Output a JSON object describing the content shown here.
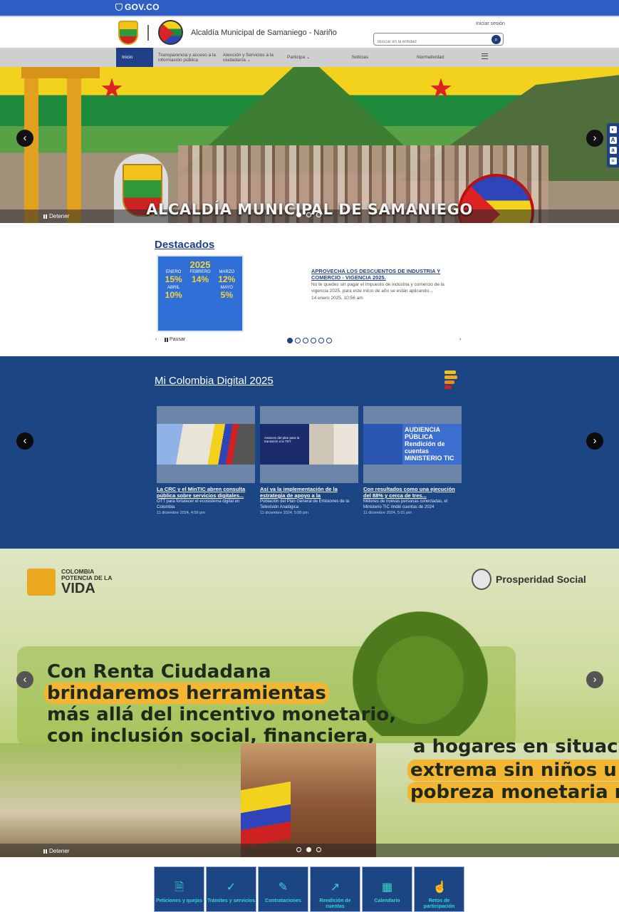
{
  "gov": {
    "logo_text": "GOV.CO"
  },
  "header": {
    "municipality_name": "Alcaldía Municipal de Samaniego - Nariño",
    "login_link": "Iniciar sesión",
    "search_placeholder": "Buscar en la entidad"
  },
  "nav": {
    "items": [
      {
        "label": "Inicio"
      },
      {
        "label": "Transparencia y acceso a la información pública"
      },
      {
        "label": "Atención y Servicios a la ciudadanía ⌄"
      },
      {
        "label": "Participa ⌄"
      },
      {
        "label": "Noticias"
      },
      {
        "label": "Normatividad"
      }
    ]
  },
  "hero": {
    "title": "ALCALDÍA MUNICIPAL DE SAMANIEGO",
    "stop_label": "Detener",
    "slides_total": 3,
    "slide_active": 1,
    "prev_icon": "chevron-left-icon",
    "next_icon": "chevron-right-icon"
  },
  "destacados": {
    "title": "Destacados",
    "poster": {
      "year": "2025",
      "cells": [
        {
          "month": "ENERO",
          "pct": "15%"
        },
        {
          "month": "FEBRERO",
          "pct": "14%"
        },
        {
          "month": "MARZO",
          "pct": "12%"
        },
        {
          "month": "ABRIL",
          "pct": "10%"
        },
        {
          "month": "",
          "pct": ""
        },
        {
          "month": "MAYO",
          "pct": "5%"
        }
      ]
    },
    "news_title": "APROVECHA LOS DESCUENTOS DE INDUSTRIA Y COMERCIO - VIGENCIA 2025.",
    "news_desc": "No te quedes sin pagar el impuesto de industria y comercio de la vigencia 2025, para este inicio de año se están aplicando...",
    "news_date": "14 enero 2025, 10:56 am",
    "pause_label": "Pausar",
    "slides_total": 6,
    "slide_active": 1
  },
  "mcd": {
    "title": "Mi Colombia Digital 2025",
    "cards": [
      {
        "title": "La CRC y el MinTIC abren consulta pública sobre servicios digitales...",
        "desc": "OTT para fortalecer el ecosistema digital en Colombia",
        "date": "11 diciembre 2024, 4:59 pm"
      },
      {
        "title": "Así va la implementación de la estrategia de apoyo a la",
        "desc": "Población del Plan General de Emisiones de la Televisión Analógica",
        "date": "11 diciembre 2024, 5:00 pm"
      },
      {
        "title": "Con resultados como una ejecución del 88% y cerca de tres...",
        "desc": "Millones de nuevas personas conectadas, el Ministerio TIC rindió cuentas de 2024",
        "date": "11 diciembre 2024, 5:01 pm"
      }
    ],
    "card_overlays": [
      "",
      "Avances del plan para la transición a la TDT",
      "AUDIENCIA PÚBLICA Rendición de cuentas MINISTERIO TIC"
    ]
  },
  "renta": {
    "logo_line1": "COLOMBIA",
    "logo_line2": "POTENCIA DE LA",
    "logo_big": "VIDA",
    "prosperidad": "Prosperidad Social",
    "line1": "Con Renta Ciudadana",
    "line2": "brindaremos herramientas",
    "line3": "más allá del incentivo monetario,",
    "line4": "con inclusión social, financiera,",
    "line5": "a hogares en situación",
    "line6": "extrema sin niños u h",
    "line7": "pobreza monetaria me",
    "stop_label": "Detener",
    "slides_total": 3,
    "slide_active": 2
  },
  "tiles": [
    {
      "label": "Peticiones y quejas",
      "icon": "document-icon"
    },
    {
      "label": "Trámites y servicios",
      "icon": "check-icon"
    },
    {
      "label": "Contrataciones",
      "icon": "contract-icon"
    },
    {
      "label": "Rendición de cuentas",
      "icon": "chart-icon"
    },
    {
      "label": "Calendario",
      "icon": "calendar-icon"
    },
    {
      "label": "Retos de participación",
      "icon": "hand-icon"
    }
  ],
  "colors": {
    "gov_blue": "#2f5ec4",
    "primary": "#1f3f87",
    "mcd_bg": "#1b4583",
    "tile_accent": "#3ad4d0",
    "highlight": "#f2b632"
  }
}
